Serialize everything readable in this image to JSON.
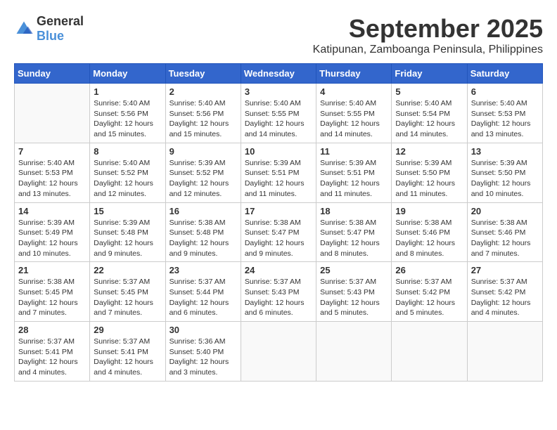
{
  "logo": {
    "general": "General",
    "blue": "Blue"
  },
  "title": "September 2025",
  "location": "Katipunan, Zamboanga Peninsula, Philippines",
  "days_of_week": [
    "Sunday",
    "Monday",
    "Tuesday",
    "Wednesday",
    "Thursday",
    "Friday",
    "Saturday"
  ],
  "weeks": [
    [
      {
        "day": "",
        "info": ""
      },
      {
        "day": "1",
        "info": "Sunrise: 5:40 AM\nSunset: 5:56 PM\nDaylight: 12 hours\nand 15 minutes."
      },
      {
        "day": "2",
        "info": "Sunrise: 5:40 AM\nSunset: 5:56 PM\nDaylight: 12 hours\nand 15 minutes."
      },
      {
        "day": "3",
        "info": "Sunrise: 5:40 AM\nSunset: 5:55 PM\nDaylight: 12 hours\nand 14 minutes."
      },
      {
        "day": "4",
        "info": "Sunrise: 5:40 AM\nSunset: 5:55 PM\nDaylight: 12 hours\nand 14 minutes."
      },
      {
        "day": "5",
        "info": "Sunrise: 5:40 AM\nSunset: 5:54 PM\nDaylight: 12 hours\nand 14 minutes."
      },
      {
        "day": "6",
        "info": "Sunrise: 5:40 AM\nSunset: 5:53 PM\nDaylight: 12 hours\nand 13 minutes."
      }
    ],
    [
      {
        "day": "7",
        "info": "Sunrise: 5:40 AM\nSunset: 5:53 PM\nDaylight: 12 hours\nand 13 minutes."
      },
      {
        "day": "8",
        "info": "Sunrise: 5:40 AM\nSunset: 5:52 PM\nDaylight: 12 hours\nand 12 minutes."
      },
      {
        "day": "9",
        "info": "Sunrise: 5:39 AM\nSunset: 5:52 PM\nDaylight: 12 hours\nand 12 minutes."
      },
      {
        "day": "10",
        "info": "Sunrise: 5:39 AM\nSunset: 5:51 PM\nDaylight: 12 hours\nand 11 minutes."
      },
      {
        "day": "11",
        "info": "Sunrise: 5:39 AM\nSunset: 5:51 PM\nDaylight: 12 hours\nand 11 minutes."
      },
      {
        "day": "12",
        "info": "Sunrise: 5:39 AM\nSunset: 5:50 PM\nDaylight: 12 hours\nand 11 minutes."
      },
      {
        "day": "13",
        "info": "Sunrise: 5:39 AM\nSunset: 5:50 PM\nDaylight: 12 hours\nand 10 minutes."
      }
    ],
    [
      {
        "day": "14",
        "info": "Sunrise: 5:39 AM\nSunset: 5:49 PM\nDaylight: 12 hours\nand 10 minutes."
      },
      {
        "day": "15",
        "info": "Sunrise: 5:39 AM\nSunset: 5:48 PM\nDaylight: 12 hours\nand 9 minutes."
      },
      {
        "day": "16",
        "info": "Sunrise: 5:38 AM\nSunset: 5:48 PM\nDaylight: 12 hours\nand 9 minutes."
      },
      {
        "day": "17",
        "info": "Sunrise: 5:38 AM\nSunset: 5:47 PM\nDaylight: 12 hours\nand 9 minutes."
      },
      {
        "day": "18",
        "info": "Sunrise: 5:38 AM\nSunset: 5:47 PM\nDaylight: 12 hours\nand 8 minutes."
      },
      {
        "day": "19",
        "info": "Sunrise: 5:38 AM\nSunset: 5:46 PM\nDaylight: 12 hours\nand 8 minutes."
      },
      {
        "day": "20",
        "info": "Sunrise: 5:38 AM\nSunset: 5:46 PM\nDaylight: 12 hours\nand 7 minutes."
      }
    ],
    [
      {
        "day": "21",
        "info": "Sunrise: 5:38 AM\nSunset: 5:45 PM\nDaylight: 12 hours\nand 7 minutes."
      },
      {
        "day": "22",
        "info": "Sunrise: 5:37 AM\nSunset: 5:45 PM\nDaylight: 12 hours\nand 7 minutes."
      },
      {
        "day": "23",
        "info": "Sunrise: 5:37 AM\nSunset: 5:44 PM\nDaylight: 12 hours\nand 6 minutes."
      },
      {
        "day": "24",
        "info": "Sunrise: 5:37 AM\nSunset: 5:43 PM\nDaylight: 12 hours\nand 6 minutes."
      },
      {
        "day": "25",
        "info": "Sunrise: 5:37 AM\nSunset: 5:43 PM\nDaylight: 12 hours\nand 5 minutes."
      },
      {
        "day": "26",
        "info": "Sunrise: 5:37 AM\nSunset: 5:42 PM\nDaylight: 12 hours\nand 5 minutes."
      },
      {
        "day": "27",
        "info": "Sunrise: 5:37 AM\nSunset: 5:42 PM\nDaylight: 12 hours\nand 4 minutes."
      }
    ],
    [
      {
        "day": "28",
        "info": "Sunrise: 5:37 AM\nSunset: 5:41 PM\nDaylight: 12 hours\nand 4 minutes."
      },
      {
        "day": "29",
        "info": "Sunrise: 5:37 AM\nSunset: 5:41 PM\nDaylight: 12 hours\nand 4 minutes."
      },
      {
        "day": "30",
        "info": "Sunrise: 5:36 AM\nSunset: 5:40 PM\nDaylight: 12 hours\nand 3 minutes."
      },
      {
        "day": "",
        "info": ""
      },
      {
        "day": "",
        "info": ""
      },
      {
        "day": "",
        "info": ""
      },
      {
        "day": "",
        "info": ""
      }
    ]
  ]
}
